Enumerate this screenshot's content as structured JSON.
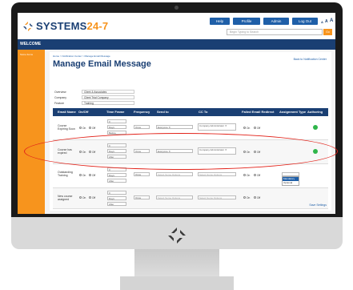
{
  "app": {
    "logo_prefix": "SYSTEMS",
    "logo_highlight": "24-7",
    "logo_icon": "systems247-mark-icon"
  },
  "header": {
    "buttons": [
      "Help",
      "Profile",
      "Admin",
      "Log Out"
    ],
    "font_sizes": [
      "A",
      "A",
      "A"
    ],
    "search_placeholder": "Begin Typing to Search",
    "go_label": "Go"
  },
  "welcome_text": "WELCOME",
  "sidebar": {
    "item": "Some Items"
  },
  "page": {
    "breadcrumb": "Home > Notification Center > Manage Email Message",
    "back_link": "Back to Notification Center",
    "title": "Manage Email Message",
    "meta": [
      {
        "label": "Overview",
        "value": "Client & Associates"
      },
      {
        "label": "Company",
        "value": "Client Trial Company"
      },
      {
        "label": "Feature",
        "value": "Training"
      }
    ],
    "save_link": "Save Settings"
  },
  "table": {
    "headers": [
      "Email Name",
      "On/Off",
      "Time Frame",
      "Frequency",
      "Send to",
      "CC To",
      "Failed Email Redirect",
      "Assignment Type",
      "Authoring Options"
    ],
    "rows": [
      {
        "name": "Course Expiring Soon",
        "on": "On",
        "off": "Off",
        "time": [
          "0",
          "Days",
          "Before"
        ],
        "frequency": "Once",
        "send_to": "Everyone ✕",
        "cc_to": "Company Administrator ✕",
        "redirect_on": "On",
        "redirect_off": "Off",
        "assignment": "",
        "authoring": true
      },
      {
        "name": "Course has expired",
        "on": "On",
        "off": "Off",
        "time": [
          "0",
          "Days",
          "After"
        ],
        "frequency": "Once",
        "send_to": "Everyone ✕",
        "cc_to": "Company Administrator ✕",
        "redirect_on": "On",
        "redirect_off": "Off",
        "assignment": "",
        "authoring": true
      },
      {
        "name": "Outstanding Training",
        "on": "On",
        "off": "Off",
        "time": [
          "0",
          "Days",
          "After"
        ],
        "frequency": "Once",
        "send_to": "Select Some Options",
        "cc_to": "Select Some Options",
        "redirect_on": "On",
        "redirect_off": "Off",
        "assignment": "",
        "assignment_options": [
          "Mandatory",
          "Optional"
        ],
        "authoring": false
      },
      {
        "name": "New course assigned",
        "on": "On",
        "off": "Off",
        "time": [
          "0",
          "Days",
          "After"
        ],
        "frequency": "Once",
        "send_to": "Select Some Options",
        "cc_to": "Select Some Options",
        "redirect_on": "On",
        "redirect_off": "Off",
        "assignment": "",
        "authoring": false
      }
    ]
  },
  "colors": {
    "navy": "#1a3f73",
    "orange": "#f7941d",
    "blue": "#1f5fa8",
    "green": "#2fb54a",
    "highlight": "#e2231a"
  }
}
